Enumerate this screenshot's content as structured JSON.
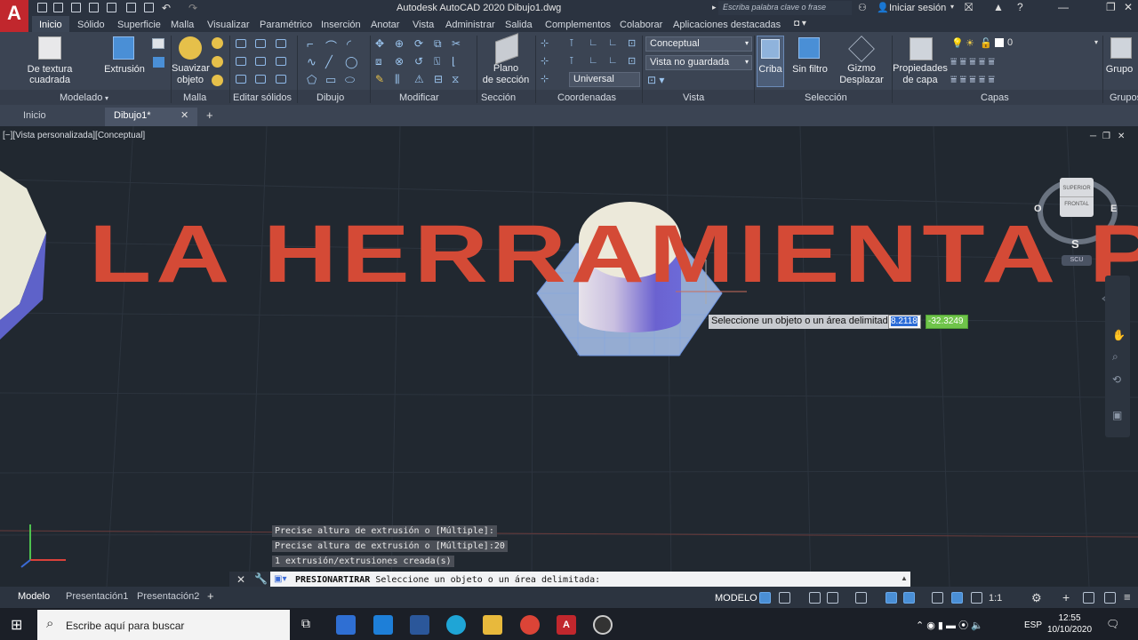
{
  "window": {
    "title": "Autodesk AutoCAD 2020   Dibujo1.dwg",
    "search_placeholder": "Escriba palabra clave o frase",
    "login": "Iniciar sesión"
  },
  "ribbon_tabs": [
    "Inicio",
    "Sólido",
    "Superficie",
    "Malla",
    "Visualizar",
    "Paramétrico",
    "Inserción",
    "Anotar",
    "Vista",
    "Administrar",
    "Salida",
    "Complementos",
    "Colaborar",
    "Aplicaciones destacadas"
  ],
  "ribbon": {
    "big_buttons": {
      "textura": "De textura cuadrada",
      "extrusion": "Extrusión",
      "suavizar": "Suavizar\nobjeto",
      "plano": "Plano\nde sección",
      "criba": "Criba",
      "sin_filtro": "Sin filtro",
      "gizmo": "Gizmo\nDesplazar",
      "propiedades": "Propiedades\nde capa",
      "grupo": "Grupo"
    },
    "dropdowns": {
      "visual_style": "Conceptual",
      "view": "Vista no guardada",
      "ucs": "Universal",
      "layer": "0"
    },
    "panel_labels": [
      "Modelado",
      "Malla",
      "Editar sólidos",
      "Dibujo",
      "Modificar",
      "Sección",
      "Coordenadas",
      "Vista",
      "Selección",
      "Capas",
      "Grupos"
    ]
  },
  "doc_tabs": {
    "start": "Inicio",
    "active": "Dibujo1*"
  },
  "viewport": {
    "label": "[−][Vista personalizada][Conceptual]",
    "background_text": "LA HERRAMIENTA PRESIO",
    "viewcube": {
      "top": "SUPERIOR",
      "front": "FRONTAL",
      "west": "O",
      "east": "E",
      "south": "S",
      "ucs": "SCU"
    }
  },
  "dynamic_input": {
    "prompt": "Seleccione un objeto o un área delimitada:",
    "x_value": "8.2118",
    "y_value": "-32.3249"
  },
  "command_history": [
    "Precise altura de extrusión o [Múltiple]:",
    "Precise altura de extrusión o [Múltiple]:20",
    "1 extrusión/extrusiones creada(s)"
  ],
  "command_line": {
    "command": "PRESIONARTIRAR",
    "prompt": "Seleccione un objeto o un área delimitada:"
  },
  "layout_tabs": [
    "Modelo",
    "Presentación1",
    "Presentación2"
  ],
  "status": {
    "model": "MODELO",
    "scale": "1:1"
  },
  "taskbar": {
    "search": "Escribe aquí para buscar",
    "lang": "ESP",
    "time": "12:55",
    "date": "10/10/2020"
  },
  "colors": {
    "ribbon_bg": "#3b4453",
    "canvas_bg": "#212830",
    "accent_red": "#c1272d",
    "highlight_blue": "#4a8fd6"
  }
}
